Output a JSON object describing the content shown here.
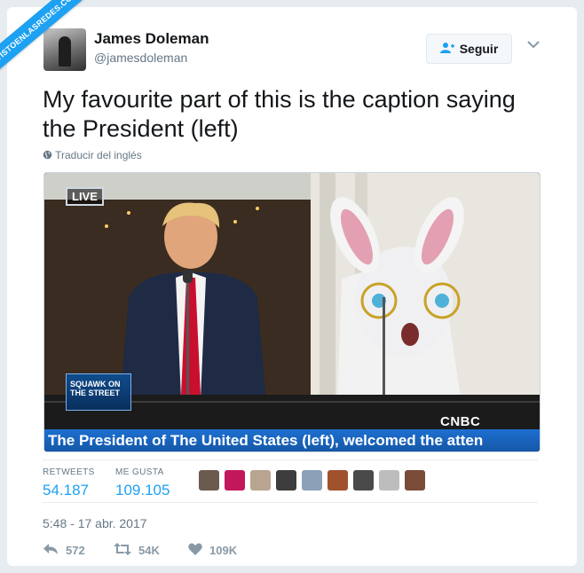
{
  "watermark": {
    "text": "VISTOENLASREDES.COM"
  },
  "author": {
    "name": "James Doleman",
    "handle": "@jamesdoleman"
  },
  "follow_button": {
    "label": "Seguir",
    "icon": "follow-user-icon"
  },
  "tweet": {
    "text": "My favourite part of this is the caption saying the President (left)",
    "translate_label": "Traducir del inglés"
  },
  "media": {
    "live_label": "LIVE",
    "show_logo": "SQUAWK ON THE STREET",
    "network": "CNBC",
    "caption": "The President of The United States (left), welcomed the atten"
  },
  "stats": {
    "retweets_label": "RETWEETS",
    "retweets_value": "54.187",
    "likes_label": "ME GUSTA",
    "likes_value": "109.105"
  },
  "likers": [
    "#6b5a4e",
    "#c2185b",
    "#b9a48f",
    "#3d3d3d",
    "#8aa1b8",
    "#a0522d",
    "#4a4a4a",
    "#bdbdbd",
    "#7b4b3a"
  ],
  "timestamp": "5:48 - 17 abr. 2017",
  "actions": {
    "reply_count": "572",
    "retweet_count": "54K",
    "like_count": "109K"
  },
  "colors": {
    "accent": "#1da1f2",
    "muted": "#657786",
    "background": "#e6ecf0"
  }
}
